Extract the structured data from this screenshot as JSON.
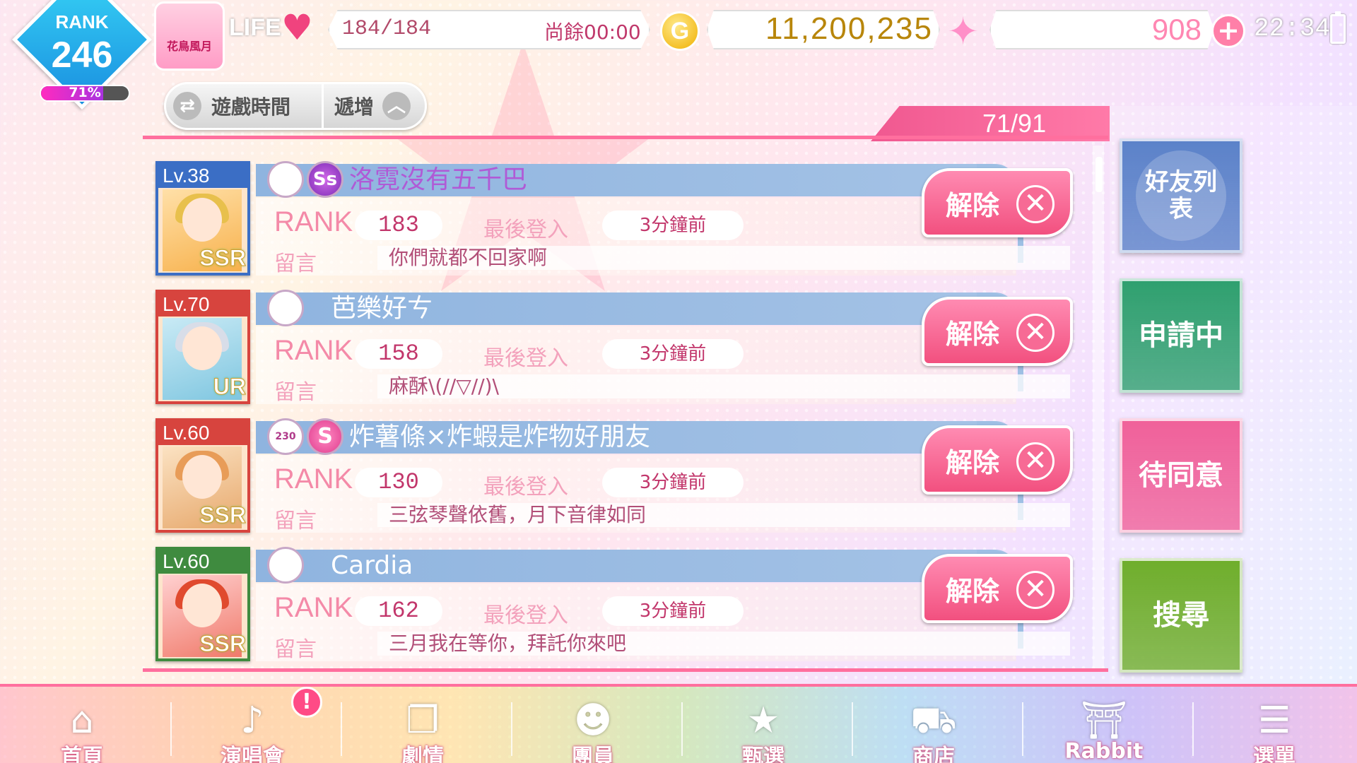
{
  "header": {
    "rank_label": "RANK",
    "rank_value": "246",
    "rank_progress_text": "71%",
    "rank_progress": 0.71,
    "event_badge": "花鳥風月",
    "life_label": "LIFE",
    "life_value": "184/184",
    "life_remaining": "尚餘00:00",
    "gold_icon": "G",
    "gold_value": "11,200,235",
    "gem_value": "908",
    "time": "22:34"
  },
  "sort": {
    "sort_label": "遊戲時間",
    "order_label": "遞增"
  },
  "friend_count": "71/91",
  "friends": [
    {
      "level": "Lv.38",
      "rarity": "SSR",
      "name": "洛霓沒有五千巴",
      "rank_label": "RANK",
      "rank": "183",
      "last_login_label": "最後登入",
      "last_login": "3分鐘前",
      "message_label": "留言",
      "message": "你們就都不回家啊",
      "remove_label": "解除",
      "badge1": "",
      "badge2": "Ss",
      "name_color": "#b05ad6"
    },
    {
      "level": "Lv.70",
      "rarity": "UR",
      "name": "芭樂好ㄘ",
      "rank_label": "RANK",
      "rank": "158",
      "last_login_label": "最後登入",
      "last_login": "3分鐘前",
      "message_label": "留言",
      "message": "麻酥\\(//▽//)\\",
      "remove_label": "解除",
      "badge1": "",
      "badge2": "",
      "name_color": "#ffffff"
    },
    {
      "level": "Lv.60",
      "rarity": "SSR",
      "name": "炸薯條×炸蝦是炸物好朋友",
      "rank_label": "RANK",
      "rank": "130",
      "last_login_label": "最後登入",
      "last_login": "3分鐘前",
      "message_label": "留言",
      "message": "三弦琴聲依舊，月下音律如同",
      "remove_label": "解除",
      "badge1": "230",
      "badge2": "S",
      "name_color": "#ffffff"
    },
    {
      "level": "Lv.60",
      "rarity": "SSR",
      "name": "Cardia",
      "rank_label": "RANK",
      "rank": "162",
      "last_login_label": "最後登入",
      "last_login": "3分鐘前",
      "message_label": "留言",
      "message": "三月我在等你，拜託你來吧",
      "remove_label": "解除",
      "badge1": "",
      "badge2": "",
      "name_color": "#ffffff"
    }
  ],
  "side_nav": [
    {
      "label": "好友列表",
      "color": "#5b82c9"
    },
    {
      "label": "申請中",
      "color": "#2fa06f"
    },
    {
      "label": "待同意",
      "color": "#f0619a"
    },
    {
      "label": "搜尋",
      "color": "#6fae2c"
    }
  ],
  "bottom_nav": [
    {
      "label": "首頁",
      "icon": "home-icon"
    },
    {
      "label": "演唱會",
      "icon": "music-note-icon"
    },
    {
      "label": "劇情",
      "icon": "book-icon"
    },
    {
      "label": "團員",
      "icon": "member-icon"
    },
    {
      "label": "甄選",
      "icon": "gacha-card-icon"
    },
    {
      "label": "商店",
      "icon": "shop-basket-icon"
    },
    {
      "label": "Rabbit Hall",
      "icon": "hall-gate-icon"
    },
    {
      "label": "選單",
      "icon": "menu-list-icon"
    }
  ],
  "notice_mark": "!"
}
